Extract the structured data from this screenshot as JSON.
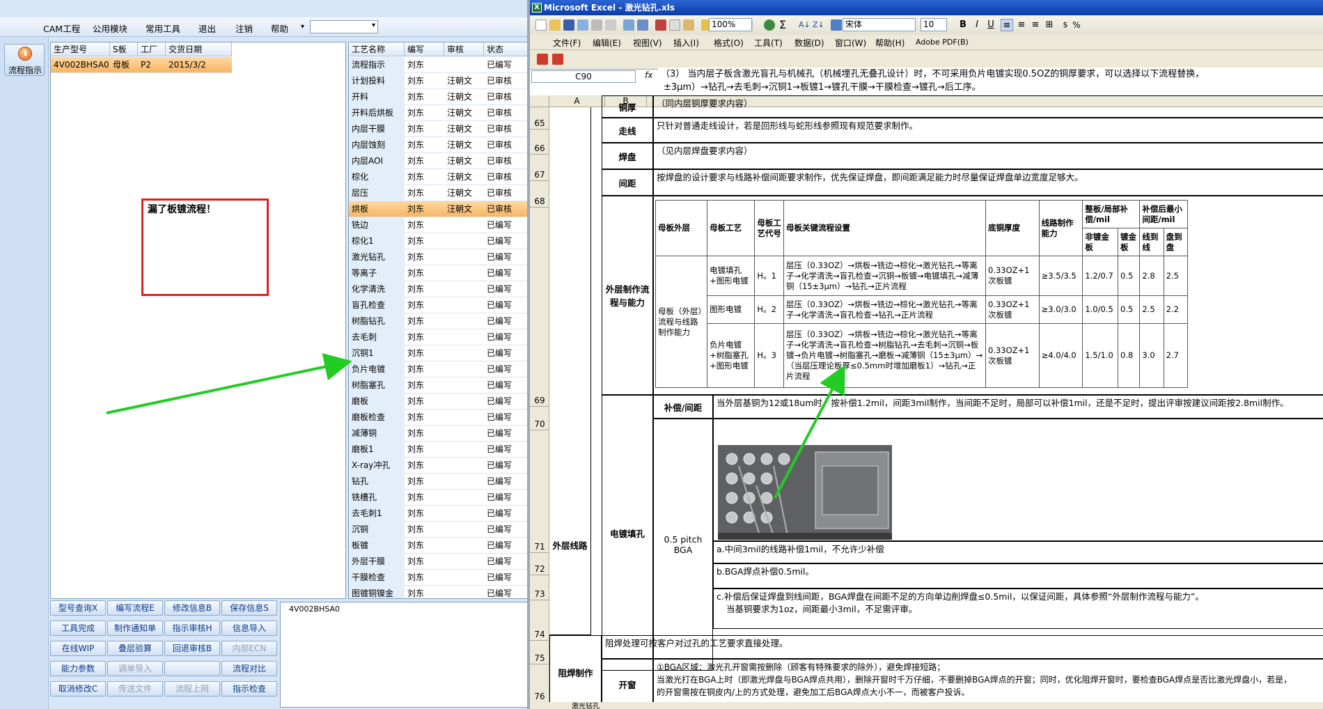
{
  "cam": {
    "menu": [
      "CAM工程",
      "公用模块",
      "常用工具",
      "退出",
      "注销",
      "帮助"
    ],
    "combo_value": "",
    "side_button": "流程指示",
    "product_grid": {
      "headers": [
        "生产型号",
        "S板",
        "工厂",
        "交货日期"
      ],
      "rows": [
        [
          "4V002BHSA0",
          "母板",
          "P2",
          "2015/3/2"
        ]
      ]
    },
    "process_grid": {
      "headers": [
        "工艺名称",
        "编写",
        "审核",
        "状态"
      ],
      "rows": [
        [
          "流程指示",
          "刘东",
          "",
          "已编写"
        ],
        [
          "计划投料",
          "刘东",
          "汪朝文",
          "已审核"
        ],
        [
          "开料",
          "刘东",
          "汪朝文",
          "已审核"
        ],
        [
          "开料后烘板",
          "刘东",
          "汪朝文",
          "已审核"
        ],
        [
          "内层干膜",
          "刘东",
          "汪朝文",
          "已审核"
        ],
        [
          "内层蚀刻",
          "刘东",
          "汪朝文",
          "已审核"
        ],
        [
          "内层AOI",
          "刘东",
          "汪朝文",
          "已审核"
        ],
        [
          "棕化",
          "刘东",
          "汪朝文",
          "已审核"
        ],
        [
          "层压",
          "刘东",
          "汪朝文",
          "已审核"
        ],
        [
          "烘板",
          "刘东",
          "汪朝文",
          "已审核"
        ],
        [
          "铣边",
          "刘东",
          "",
          "已编写"
        ],
        [
          "棕化1",
          "刘东",
          "",
          "已编写"
        ],
        [
          "激光钻孔",
          "刘东",
          "",
          "已编写"
        ],
        [
          "等离子",
          "刘东",
          "",
          "已编写"
        ],
        [
          "化学清洗",
          "刘东",
          "",
          "已编写"
        ],
        [
          "盲孔检查",
          "刘东",
          "",
          "已编写"
        ],
        [
          "树脂钻孔",
          "刘东",
          "",
          "已编写"
        ],
        [
          "去毛刺",
          "刘东",
          "",
          "已编写"
        ],
        [
          "沉铜1",
          "刘东",
          "",
          "已编写"
        ],
        [
          "负片电镀",
          "刘东",
          "",
          "已编写"
        ],
        [
          "树脂塞孔",
          "刘东",
          "",
          "已编写"
        ],
        [
          "磨板",
          "刘东",
          "",
          "已编写"
        ],
        [
          "磨板检查",
          "刘东",
          "",
          "已编写"
        ],
        [
          "减薄铜",
          "刘东",
          "",
          "已编写"
        ],
        [
          "磨板1",
          "刘东",
          "",
          "已编写"
        ],
        [
          "X-ray冲孔",
          "刘东",
          "",
          "已编写"
        ],
        [
          "钻孔",
          "刘东",
          "",
          "已编写"
        ],
        [
          "铣槽孔",
          "刘东",
          "",
          "已编写"
        ],
        [
          "去毛刺1",
          "刘东",
          "",
          "已编写"
        ],
        [
          "沉铜",
          "刘东",
          "",
          "已编写"
        ],
        [
          "板镀",
          "刘东",
          "",
          "已编写"
        ],
        [
          "外层干膜",
          "刘东",
          "",
          "已编写"
        ],
        [
          "干膜检查",
          "刘东",
          "",
          "已编写"
        ],
        [
          "图镀铜镍金",
          "刘东",
          "",
          "已编写"
        ]
      ]
    },
    "annotation": "漏了板镀流程！",
    "buttons": [
      [
        "型号查询X",
        "编写流程E",
        "修改信息B",
        "保存信息S"
      ],
      [
        "工具完成",
        "制作通知单",
        "指示审核H",
        "信息导入"
      ],
      [
        "在线WIP",
        "叠层验算",
        "回退审核B",
        "内部ECN"
      ],
      [
        "能力参数",
        "调单导入",
        "",
        "流程对比"
      ],
      [
        "取消修改C",
        "传送文件",
        "流程上网",
        "指示检查"
      ]
    ],
    "info_text": "4V002BHSA0"
  },
  "excel": {
    "title": "Microsoft Excel - 激光钻孔.xls",
    "zoom": "100%",
    "font_name": "宋体",
    "font_size": "10",
    "menu": [
      "文件(F)",
      "编辑(E)",
      "视图(V)",
      "插入(I)",
      "格式(O)",
      "工具(T)",
      "数据(D)",
      "窗口(W)",
      "帮助(H)",
      "Adobe PDF(B)"
    ],
    "name_box": "C90",
    "fx": "fx",
    "formula_line1": "（3） 当内层子板含激光盲孔与机械孔（机械埋孔无叠孔设计）时，不可采用负片电镀实现0.5OZ的铜厚要求，可以选择以下流程替换，",
    "formula_line2": "±3μm）→钻孔→去毛刺→沉铜1→板镀1→镀孔干膜→干膜检查→镀孔→后工序。",
    "col_headers": [
      "A",
      "B"
    ],
    "row_numbers": [
      "65",
      "66",
      "67",
      "68",
      "69",
      "70",
      "71",
      "72",
      "73",
      "74",
      "75",
      "76"
    ],
    "rows": {
      "r65_label": "铜厚",
      "r65_text": "（同内层铜厚要求内容）",
      "r66_label": "走线",
      "r66_text": "只针对普通走线设计，若是回形线与蛇形线参照现有规范要求制作。",
      "r67_label": "焊盘",
      "r67_text": "（见内层焊盘要求内容）",
      "r68_label": "间距",
      "r68_text": "按焊盘的设计要求与线路补偿间距要求制作，优先保证焊盘，即间距满足能力时尽量保证焊盘单边宽度足够大。",
      "section_outer": "外层线路",
      "r69_label": "外层制作流程与能力",
      "r70_label": "补偿/间距",
      "r70_text": "当外层基铜为12或18um时，按补偿1.2mil，间距3mil制作，当间距不足时，局部可以补偿1mil，还是不足时，提出评审按建议间距按2.8mil制作。",
      "r71_label": "电镀填孔",
      "r71_sub": "0.5 pitch BGA",
      "r72_text": "a.中间3mil的线路补偿1mil，不允许少补偿",
      "r73_text": "b.BGA焊点补偿0.5mil。",
      "r74_text": "c.补偿后保证焊盘到线间距，BGA焊盘在间距不足的方向单边削焊盘≤0.5mil，以保证间距，具体参照“外层制作流程与能力”。",
      "r74_text2": "当基铜要求为1oz，间距最小3mil，不足需评审。",
      "r75_text": "阻焊处理可按客户对过孔的工艺要求直接处理。",
      "section_mask": "阻焊制作",
      "r76_label": "开窗",
      "r76_text": "①BGA区域：激光孔开窗需按删除（顾客有特殊要求的除外），避免焊接短路；",
      "r76_text2": "当激光打在BGA上时（即激光焊盘与BGA焊点共用），删除开窗时千万仔细，不要删掉BGA焊点的开窗；同时，优化阻焊开窗时，要检查BGA焊点是否比激光焊盘小，若是，",
      "r76_text3": "的开窗需按在铜皮内/上的方式处理，避免加工后BGA焊点大小不一，而被客户投诉。"
    },
    "inner_table": {
      "headers": [
        "母板外层",
        "母板工艺",
        "母板工艺代号",
        "母板关键流程设置",
        "底铜厚度",
        "线路制作能力",
        "整板/局部补偿/mil",
        "补偿后最小间距/mil"
      ],
      "subheaders": [
        "非镀金板",
        "镀金板",
        "线到线",
        "盘到盘"
      ],
      "group_label": "母板（外层）流程与线路制作能力",
      "rows": [
        [
          "电镀填孔+图形电镀",
          "H。1",
          "层压（0.33OZ）→烘板→铣边→棕化→激光钻孔→等离子→化学清洗→盲孔检查→沉铜→板镀→电镀填孔→减薄铜（15±3μm）→钻孔→正片流程",
          "0.33OZ+1次板镀",
          "≥3.5/3.5",
          "1.2/0.7",
          "0.5",
          "2.8",
          "2.5"
        ],
        [
          "图形电镀",
          "H。2",
          "层压（0.33OZ）→烘板→铣边→棕化→激光钻孔→等离子→化学清洗→盲孔检查→钻孔→正片流程",
          "0.33OZ+1次板镀",
          "≥3.0/3.0",
          "1.0/0.5",
          "0.5",
          "2.5",
          "2.2"
        ],
        [
          "负片电镀+树脂塞孔+图形电镀",
          "H。3",
          "层压（0.33OZ）→烘板→铣边→棕化→激光钻孔→等离子→化学清洗→盲孔检查→树脂钻孔→去毛刺→沉铜→板镀→负片电镀→树脂塞孔→磨板→减薄铜（15±3μm）→（当层压理论板厚≤0.5mm时增加磨板1）→钻孔→正片流程",
          "0.33OZ+1次板镀",
          "≥4.0/4.0",
          "1.5/1.0",
          "0.8",
          "3.0",
          "2.7"
        ]
      ]
    },
    "sheet_tab": "激光钻孔"
  }
}
